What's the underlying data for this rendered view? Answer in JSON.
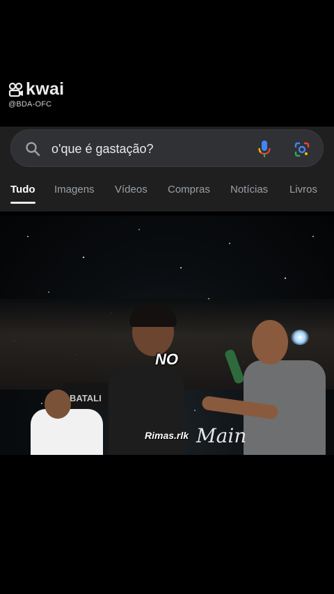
{
  "watermark": {
    "brand": "kwai",
    "handle": "@BDA-OFC",
    "logo_icon": "kwai-logo-icon"
  },
  "search": {
    "query": "o'que é gastação?",
    "icons": [
      "search-icon",
      "microphone-icon",
      "google-lens-icon"
    ]
  },
  "tabs": [
    {
      "label": "Tudo",
      "active": true
    },
    {
      "label": "Imagens",
      "active": false
    },
    {
      "label": "Vídeos",
      "active": false
    },
    {
      "label": "Compras",
      "active": false
    },
    {
      "label": "Notícias",
      "active": false
    },
    {
      "label": "Livros",
      "active": false
    }
  ],
  "video": {
    "subtitle": "NO",
    "caption": "Rimas.rlk",
    "banner_text": "BATALI",
    "logo_text": "Main"
  },
  "colors": {
    "panel_bg": "#1f1f1f",
    "searchbar_bg": "#303134",
    "tab_inactive": "#9aa0a6",
    "tab_active": "#ffffff"
  }
}
